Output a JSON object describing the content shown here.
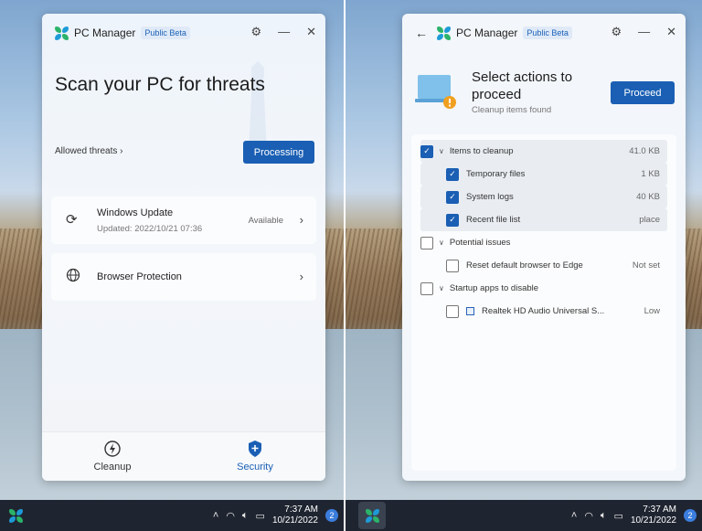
{
  "left": {
    "app": {
      "title": "PC Manager",
      "badge": "Public Beta"
    },
    "scan_title": "Scan your PC for threats",
    "allowed_threats": "Allowed threats",
    "processing_button": "Processing",
    "cards": [
      {
        "title": "Windows Update",
        "subtitle": "Updated: 2022/10/21 07:36",
        "status": "Available"
      },
      {
        "title": "Browser Protection"
      }
    ],
    "nav": {
      "cleanup": "Cleanup",
      "security": "Security"
    }
  },
  "right": {
    "app": {
      "title": "PC Manager",
      "badge": "Public Beta"
    },
    "header_title": "Select actions to proceed",
    "header_subtitle": "Cleanup items found",
    "proceed_button": "Proceed",
    "items": [
      {
        "label": "Items to cleanup",
        "value": "41.0 KB",
        "checked": true
      },
      {
        "label": "Temporary files",
        "value": "1 KB",
        "checked": true
      },
      {
        "label": "System logs",
        "value": "40 KB",
        "checked": true
      },
      {
        "label": "Recent file list",
        "value": "place",
        "checked": true
      },
      {
        "label": "Potential issues",
        "value": "",
        "checked": false
      },
      {
        "label": "Reset default browser to Edge",
        "value": "Not set",
        "checked": false
      },
      {
        "label": "Startup apps to disable",
        "value": "",
        "checked": false
      },
      {
        "label": "Realtek HD Audio Universal S...",
        "value": "Low",
        "checked": false
      }
    ]
  },
  "taskbar": {
    "time": "7:37 AM",
    "date": "10/21/2022",
    "notifications": "2"
  },
  "colors": {
    "accent": "#1a5fb4",
    "taskbar": "#1f2530"
  }
}
